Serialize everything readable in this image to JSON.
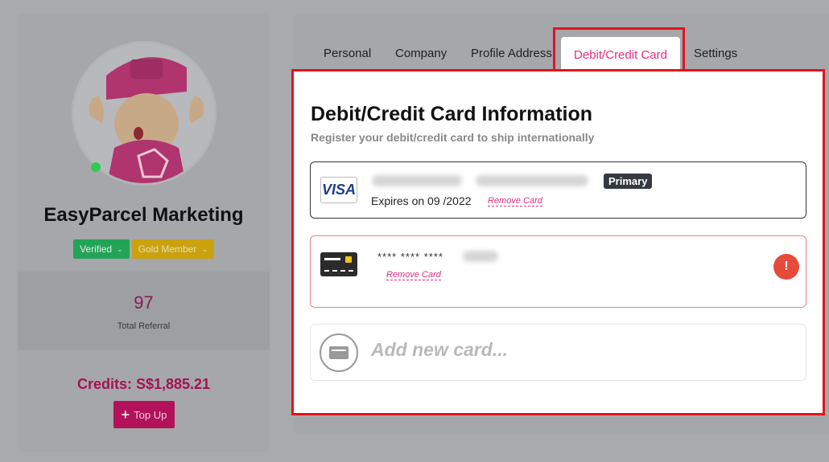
{
  "profile": {
    "name": "EasyParcel Marketing",
    "badges": {
      "verified": "Verified",
      "member": "Gold Member"
    },
    "referral": {
      "count": "97",
      "label": "Total Referral"
    },
    "credits": "Credits: S$1,885.21",
    "topup_label": "Top Up"
  },
  "tabs": [
    "Personal",
    "Company",
    "Profile Address",
    "Debit/Credit Card",
    "Settings"
  ],
  "card_section": {
    "title": "Debit/Credit Card Information",
    "subtitle": "Register your debit/credit card to ship internationally",
    "cards": [
      {
        "brand": "VISA",
        "expires": "Expires on 09 /2022",
        "remove": "Remove Card",
        "badge": "Primary"
      },
      {
        "masked": "**** **** ****",
        "remove": "Remove Card",
        "alert": "!"
      }
    ],
    "add_label": "Add new card..."
  },
  "colors": {
    "accent": "#e52b82",
    "highlight": "#e1141e"
  }
}
